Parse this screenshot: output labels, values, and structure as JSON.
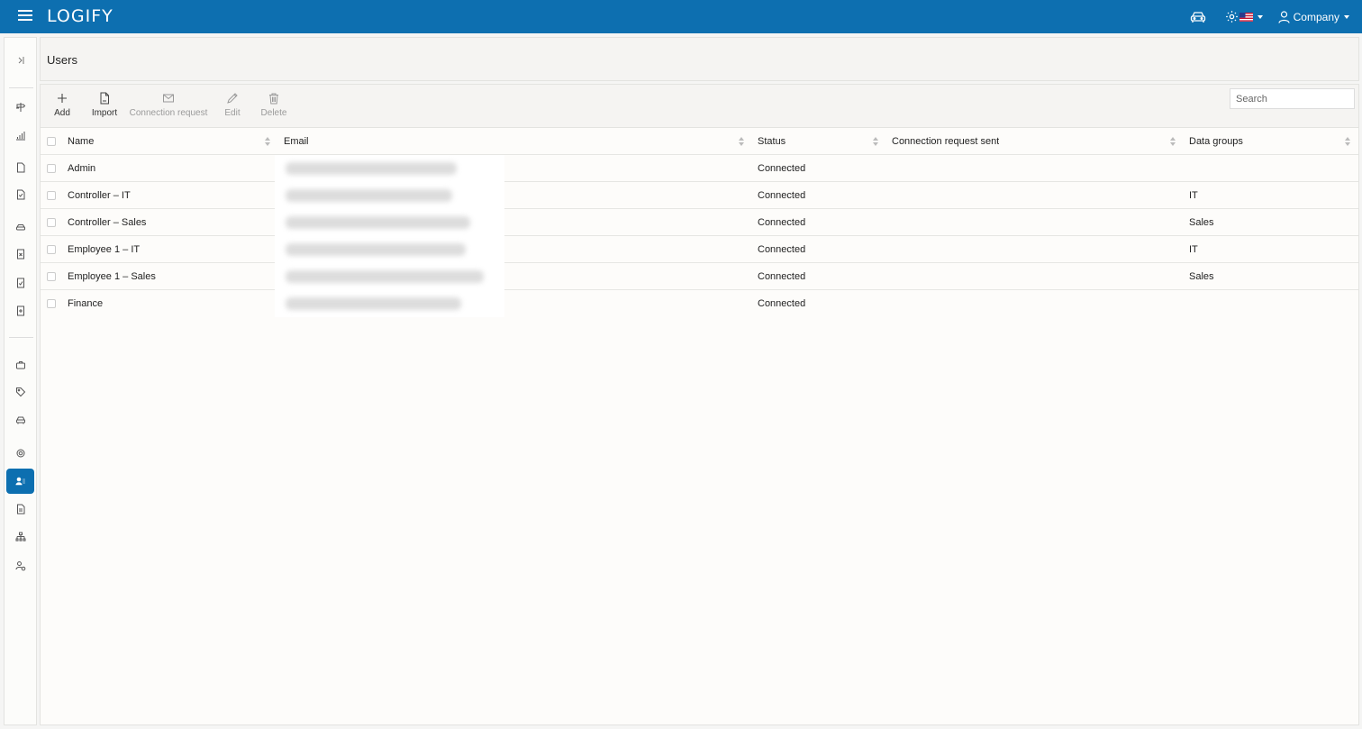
{
  "header": {
    "logo": "LOGIFY",
    "company_label": "Company"
  },
  "page": {
    "title": "Users"
  },
  "toolbar": {
    "add": "Add",
    "import": "Import",
    "connection_request": "Connection request",
    "edit": "Edit",
    "delete": "Delete",
    "search_placeholder": "Search"
  },
  "table": {
    "columns": [
      "Name",
      "Email",
      "Status",
      "Connection request sent",
      "Data groups"
    ],
    "rows": [
      {
        "name": "Admin",
        "email": "",
        "status": "Connected",
        "request_sent": "",
        "data_groups": ""
      },
      {
        "name": "Controller – IT",
        "email": "",
        "status": "Connected",
        "request_sent": "",
        "data_groups": "IT"
      },
      {
        "name": "Controller – Sales",
        "email": "",
        "status": "Connected",
        "request_sent": "",
        "data_groups": "Sales"
      },
      {
        "name": "Employee 1 – IT",
        "email": "",
        "status": "Connected",
        "request_sent": "",
        "data_groups": "IT"
      },
      {
        "name": "Employee 1 – Sales",
        "email": "",
        "status": "Connected",
        "request_sent": "",
        "data_groups": "Sales"
      },
      {
        "name": "Finance",
        "email": "",
        "status": "Connected",
        "request_sent": "",
        "data_groups": ""
      }
    ]
  },
  "icons": {
    "header": [
      "menu-icon",
      "car-icon",
      "gear-icon",
      "us-flag-icon",
      "user-icon"
    ],
    "rail": [
      "expand-icon",
      "route-icon",
      "bar-chart-icon",
      "document-icon",
      "document-check-icon",
      "vehicle-front-icon",
      "document-x-icon",
      "checkbox-doc-icon",
      "document-plus-icon",
      "briefcase-icon",
      "tag-icon",
      "car-icon",
      "gear-icon",
      "users-icon",
      "report-icon",
      "org-chart-icon",
      "user-settings-icon"
    ]
  },
  "colors": {
    "brand": "#0d6fb0",
    "background": "#f5f5f4",
    "panel": "#fdfcfa"
  }
}
